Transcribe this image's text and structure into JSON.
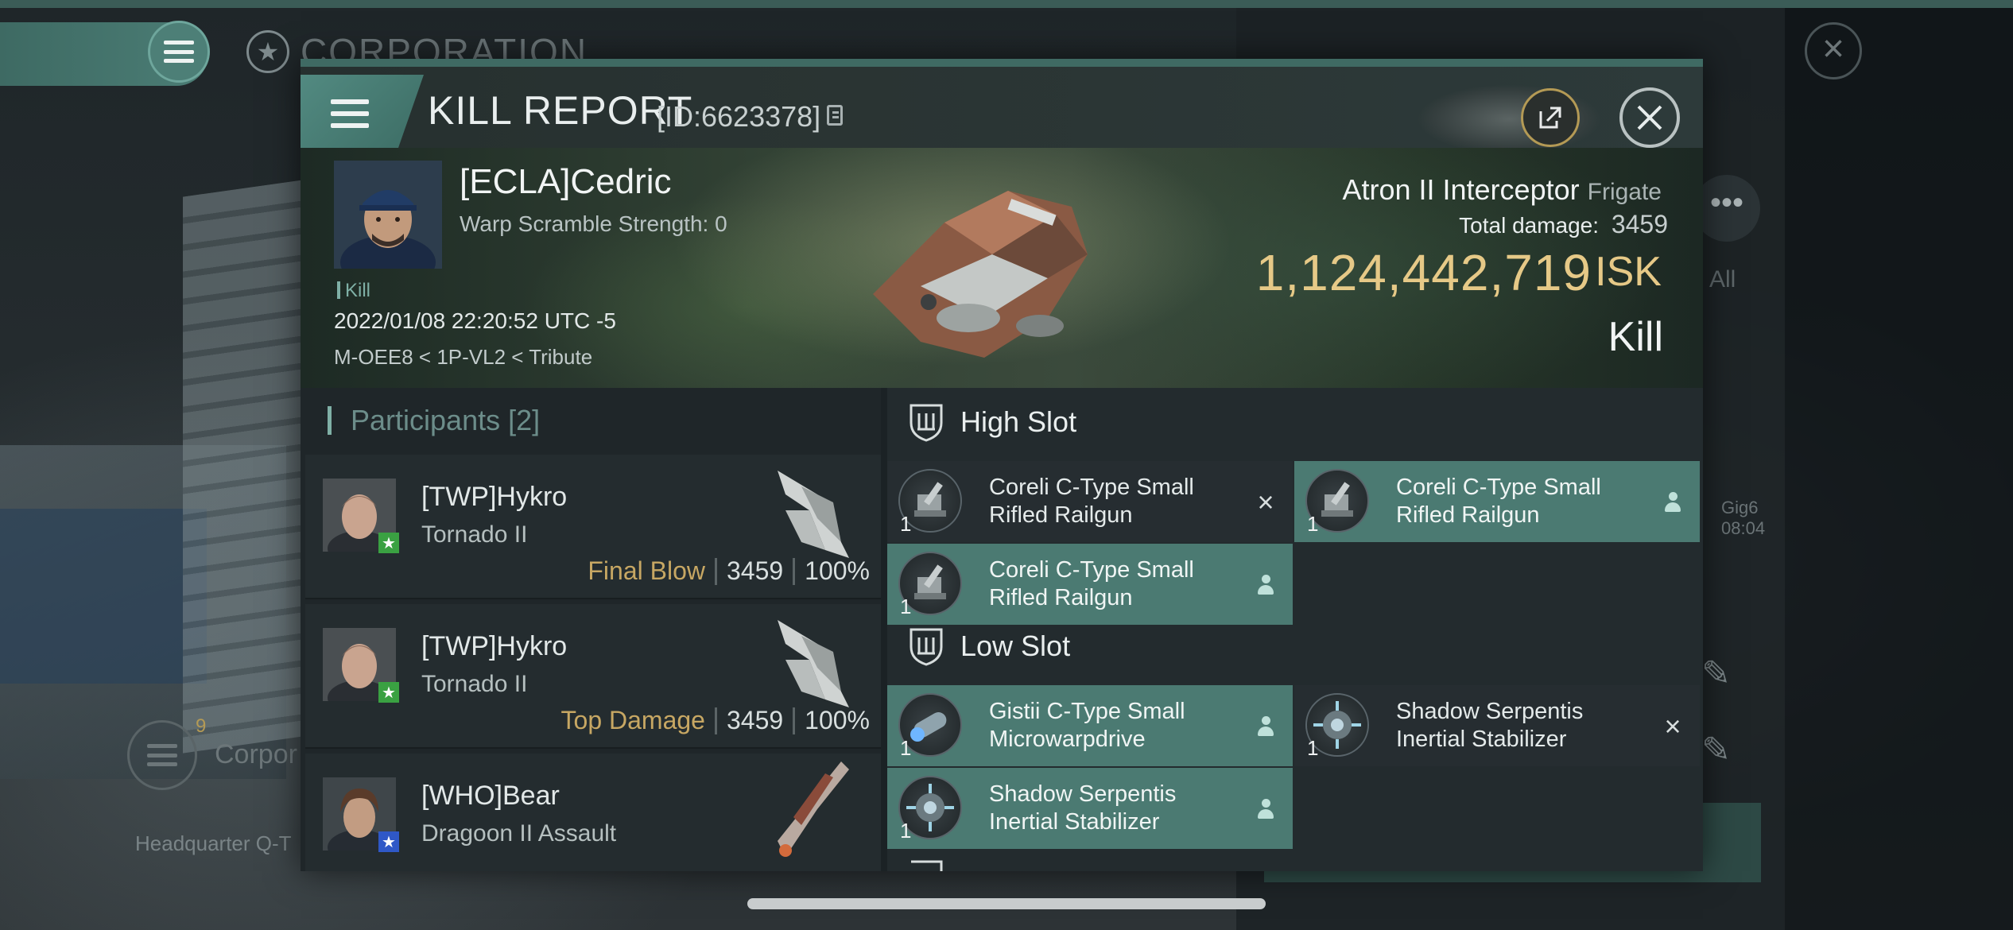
{
  "background": {
    "corp_title": "CORPORATION",
    "right_more": "•••",
    "right_all": "All",
    "right_gig": "Gig6",
    "right_gig_time": "08:04",
    "corp_badge": "9",
    "corp_label": "Corpor",
    "hq_label": "Headquarter Q-T"
  },
  "header": {
    "title": "KILL REPORT",
    "report_id": "[ID:6623378]"
  },
  "victim": {
    "name": "[ECLA]Cedric",
    "warp_scramble": "Warp Scramble Strength: 0",
    "kill_tag": "Kill",
    "datetime": "2022/01/08 22:20:52 UTC -5",
    "location": "M-OEE8 < 1P-VL2 < Tribute"
  },
  "ship": {
    "name": "Atron II Interceptor",
    "class": "Frigate",
    "total_damage_label": "Total damage:",
    "total_damage": "3459",
    "isk_value": "1,124,442,719",
    "isk_unit": "ISK",
    "result": "Kill"
  },
  "participants": {
    "label": "Participants",
    "count": "[2]",
    "rows": [
      {
        "name": "[TWP]Hykro",
        "ship": "Tornado II",
        "role": "Final Blow",
        "damage": "3459",
        "percent": "100%",
        "badge_color": "#3aa142"
      },
      {
        "name": "[TWP]Hykro",
        "ship": "Tornado II",
        "role": "Top Damage",
        "damage": "3459",
        "percent": "100%",
        "badge_color": "#3aa142"
      },
      {
        "name": "[WHO]Bear",
        "ship": "Dragoon II Assault",
        "role": "",
        "damage": "",
        "percent": "",
        "badge_color": "#2f58c7"
      }
    ]
  },
  "fittings": {
    "high_slot_label": "High Slot",
    "low_slot_label": "Low Slot",
    "high_slot": [
      {
        "qty": "1",
        "name_line1": "Coreli C-Type Small",
        "name_line2": "Rifled Railgun",
        "status": "destroyed"
      },
      {
        "qty": "1",
        "name_line1": "Coreli C-Type Small",
        "name_line2": "Rifled Railgun",
        "status": "dropped"
      },
      {
        "qty": "1",
        "name_line1": "Coreli C-Type Small",
        "name_line2": "Rifled Railgun",
        "status": "dropped"
      }
    ],
    "low_slot": [
      {
        "qty": "1",
        "name_line1": "Gistii C-Type Small",
        "name_line2": "Microwarpdrive",
        "status": "dropped"
      },
      {
        "qty": "1",
        "name_line1": "Shadow Serpentis",
        "name_line2": "Inertial Stabilizer",
        "status": "destroyed"
      },
      {
        "qty": "1",
        "name_line1": "Shadow Serpentis",
        "name_line2": "Inertial Stabilizer",
        "status": "dropped"
      }
    ]
  },
  "colors": {
    "accent_teal": "#4b7a72",
    "isk_gold": "#e6c987",
    "role_gold": "#c7a763"
  }
}
